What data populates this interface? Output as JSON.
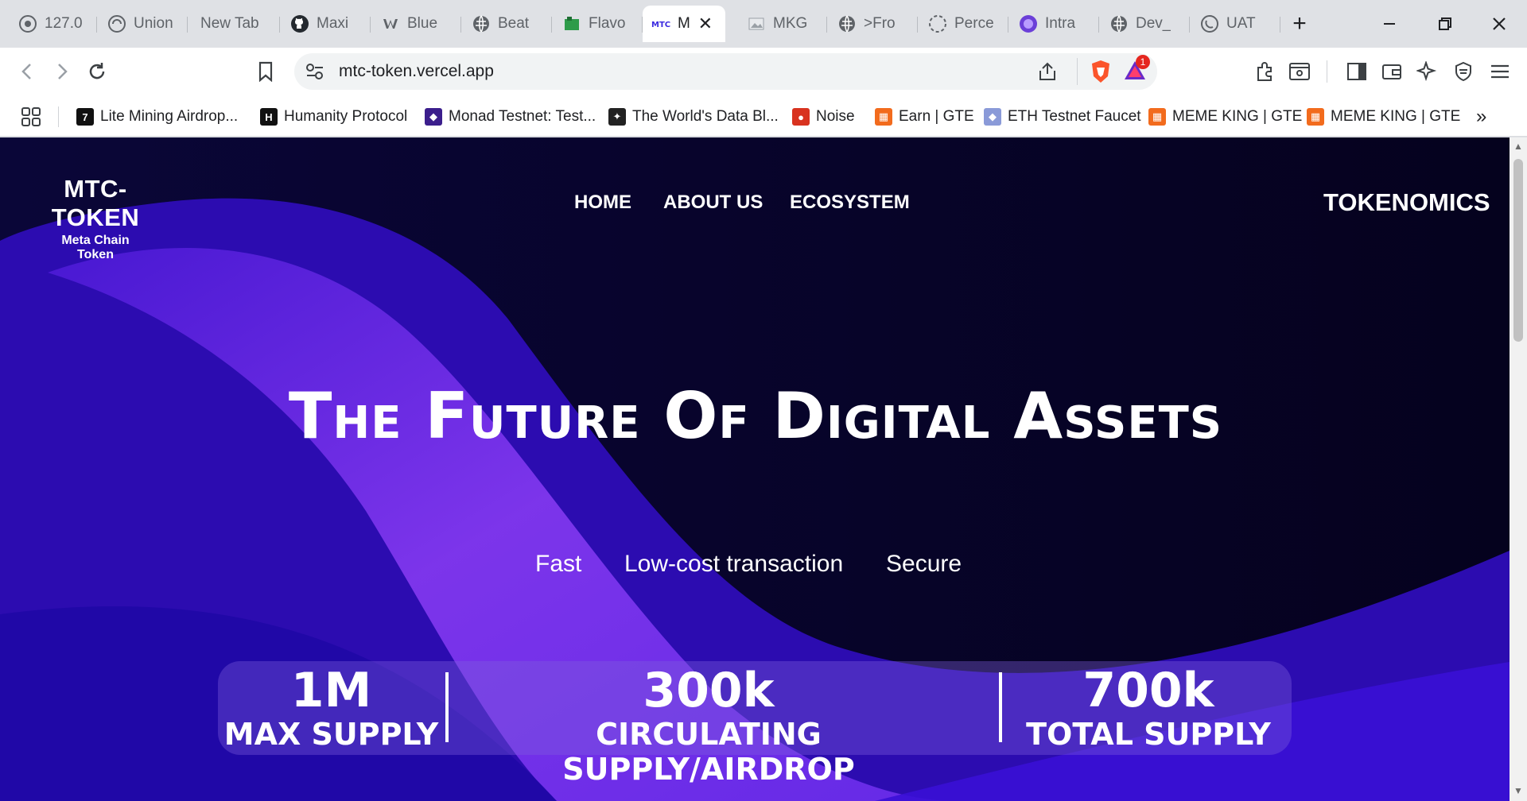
{
  "browser": {
    "tabs": [
      {
        "title": "127.0",
        "icon": "globe-icon"
      },
      {
        "title": "Union",
        "icon": "union-icon"
      },
      {
        "title": "New Tab",
        "icon": ""
      },
      {
        "title": "Maxi",
        "icon": "github-icon"
      },
      {
        "title": "Blue",
        "icon": "bluesky-icon"
      },
      {
        "title": "Beat",
        "icon": "globe-icon"
      },
      {
        "title": "Flavo",
        "icon": "flavor-icon"
      },
      {
        "title": "M",
        "icon": "mtc-icon",
        "active": true
      },
      {
        "title": "MKG",
        "icon": "image-icon"
      },
      {
        "title": ">Fro",
        "icon": "globe-icon"
      },
      {
        "title": "Perce",
        "icon": "loading-icon"
      },
      {
        "title": "Intra",
        "icon": "intract-icon"
      },
      {
        "title": "Dev_",
        "icon": "globe-icon"
      },
      {
        "title": "UAT",
        "icon": "uat-icon"
      }
    ],
    "url": "mtc-token.vercel.app",
    "notification_count": "1",
    "bookmarks": [
      {
        "label": "Lite Mining Airdrop...",
        "color": "#111111",
        "glyph": "7"
      },
      {
        "label": "Humanity Protocol",
        "color": "#111111",
        "glyph": "H"
      },
      {
        "label": "Monad Testnet: Test...",
        "color": "#3b1e8c",
        "glyph": "◆"
      },
      {
        "label": "The World's Data Bl...",
        "color": "#222222",
        "glyph": "✦"
      },
      {
        "label": "Noise",
        "color": "#d8321f",
        "glyph": "●"
      },
      {
        "label": "Earn | GTE",
        "color": "#f26b1d",
        "glyph": "▦"
      },
      {
        "label": "ETH Testnet Faucet",
        "color": "#8a9ad8",
        "glyph": "◆"
      },
      {
        "label": "MEME KING | GTE",
        "color": "#f26b1d",
        "glyph": "▦"
      },
      {
        "label": "MEME KING | GTE",
        "color": "#f26b1d",
        "glyph": "▦"
      }
    ],
    "more_bookmarks": "»"
  },
  "site": {
    "logo_main": "MTC-TOKEN",
    "logo_sub": "Meta Chain Token",
    "nav": [
      "HOME",
      "ABOUT US",
      "ECOSYSTEM"
    ],
    "tokenomics": "TOKENOMICS",
    "hero_title": "The Future Of Digital Assets",
    "features": [
      "Fast",
      "Low-cost transaction",
      "Secure"
    ],
    "stats": [
      {
        "value": "1M",
        "label": "MAX SUPPLY"
      },
      {
        "value": "300k",
        "label": "CIRCULATING SUPPLY/AIRDROP"
      },
      {
        "value": "700k",
        "label": "TOTAL SUPPLY"
      }
    ]
  },
  "colors": {
    "accent": "#5b2ee6",
    "page_dark": "#0a0530",
    "wave": "#7a3cf0"
  }
}
